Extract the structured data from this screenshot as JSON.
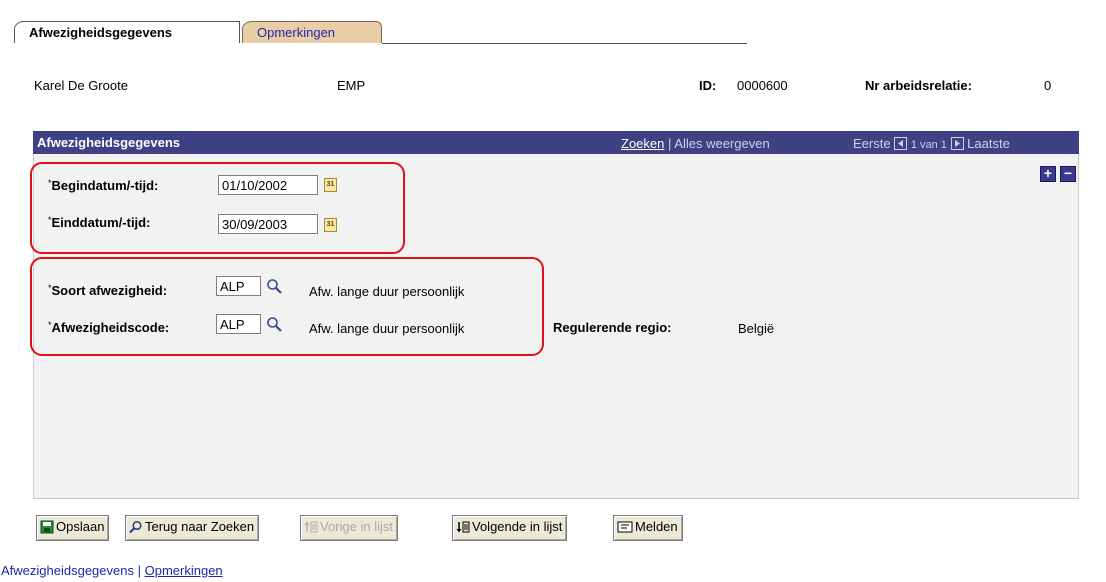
{
  "tabs": [
    {
      "label": "Afwezigheidsgegevens",
      "active": true
    },
    {
      "label": "Opmerkingen",
      "active": false
    }
  ],
  "header": {
    "name": "Karel De Groote",
    "type": "EMP",
    "id_label": "ID:",
    "id_value": "0000600",
    "relation_label": "Nr arbeidsrelatie:",
    "relation_value": "0"
  },
  "panel": {
    "title": "Afwezigheidsgegevens",
    "search_link": "Zoeken",
    "separator": "|",
    "show_all": "Alles weergeven",
    "first": "Eerste",
    "counter": "1 van 1",
    "last": "Laatste",
    "add_label": "+",
    "remove_label": "−"
  },
  "fields": {
    "required_mark": "*",
    "begin_label": "Begindatum/-tijd:",
    "begin_value": "01/10/2002",
    "end_label": "Einddatum/-tijd:",
    "end_value": "30/09/2003",
    "calendar_icon_text": "31",
    "type_label": "Soort afwezigheid:",
    "type_value": "ALP",
    "type_desc": "Afw. lange duur persoonlijk",
    "code_label": "Afwezigheidscode:",
    "code_value": "ALP",
    "code_desc": "Afw. lange duur persoonlijk",
    "region_label": "Regulerende regio:",
    "region_value": "België"
  },
  "buttons": [
    {
      "label": "Opslaan",
      "icon": "save-icon",
      "enabled": true
    },
    {
      "label": "Terug naar Zoeken",
      "icon": "search-back-icon",
      "enabled": true
    },
    {
      "label": "Vorige in lijst",
      "icon": "previous-in-list-icon",
      "enabled": false
    },
    {
      "label": "Volgende in lijst",
      "icon": "next-in-list-icon",
      "enabled": true
    },
    {
      "label": "Melden",
      "icon": "notify-icon",
      "enabled": true
    }
  ],
  "footer": {
    "link1": "Afwezigheidsgegevens",
    "separator": "|",
    "link2": "Opmerkingen"
  },
  "colors": {
    "panel_header": "#404084",
    "tab_inactive": "#e8cda6",
    "highlight": "#e0101a",
    "link": "#1f27a8"
  }
}
